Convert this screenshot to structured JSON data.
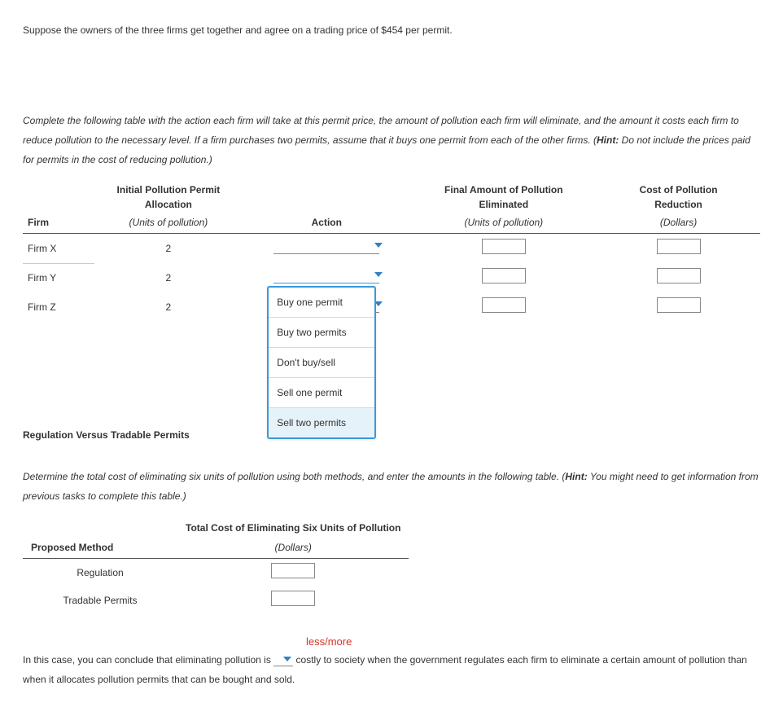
{
  "intro": "Suppose the owners of the three firms get together and agree on a trading price of $454 per permit.",
  "task_para": {
    "pre": "Complete the following table with the action each firm will take at this permit price, the amount of pollution each firm will eliminate, and the amount it costs each firm to reduce pollution to the necessary level. If a firm purchases two permits, assume that it buys one permit from each of the other firms. (",
    "hint_label": "Hint:",
    "hint_text": " Do not include the prices paid for permits in the cost of reducing pollution.)"
  },
  "table1": {
    "headers": {
      "firm": "Firm",
      "alloc_top": "Initial Pollution Permit",
      "alloc_bot": "Allocation",
      "alloc_unit": "(Units of pollution)",
      "action": "Action",
      "final_top": "Final Amount of Pollution",
      "final_bot": "Eliminated",
      "final_unit": "(Units of pollution)",
      "cost_top": "Cost of Pollution",
      "cost_bot": "Reduction",
      "cost_unit": "(Dollars)"
    },
    "rows": [
      {
        "firm": "Firm X",
        "alloc": "2"
      },
      {
        "firm": "Firm Y",
        "alloc": "2"
      },
      {
        "firm": "Firm Z",
        "alloc": "2"
      }
    ],
    "dropdown_options": [
      "Buy one permit",
      "Buy two permits",
      "Don't buy/sell",
      "Sell one permit",
      "Sell two permits"
    ]
  },
  "section_heading": "Regulation Versus Tradable Permits",
  "determine_para": {
    "pre": "Determine the total cost of eliminating six units of pollution using both methods, and enter the amounts in the following table. (",
    "hint_label": "Hint:",
    "hint_text": " You might need to get information from previous tasks to complete this table.)"
  },
  "table2": {
    "headers": {
      "method": "Proposed Method",
      "total_top": "Total Cost of Eliminating Six Units of Pollution",
      "total_unit": "(Dollars)"
    },
    "rows": [
      {
        "method": "Regulation"
      },
      {
        "method": "Tradable Permits"
      }
    ]
  },
  "less_more": "less/more",
  "final": {
    "pre": "In this case, you can conclude that eliminating pollution is ",
    "post": " costly to society when the government regulates each firm to eliminate a certain amount of pollution than when it allocates pollution permits that can be bought and sold."
  }
}
